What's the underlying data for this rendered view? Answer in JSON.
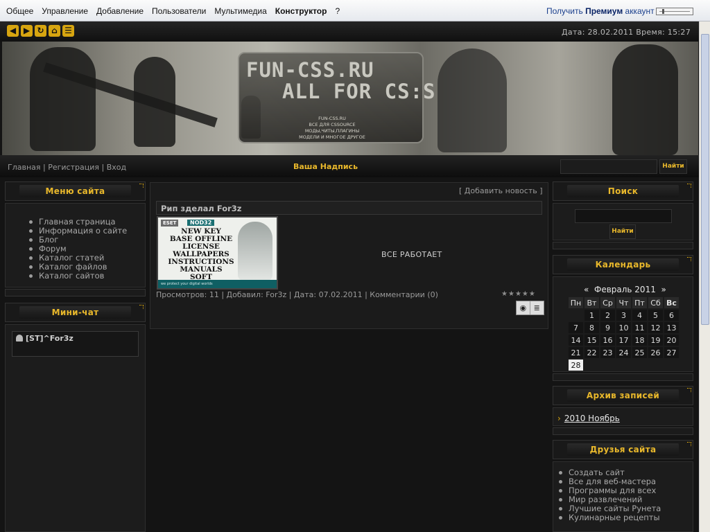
{
  "topbar": {
    "menu": [
      "Общее",
      "Управление",
      "Добавление",
      "Пользователи",
      "Мультимедиа",
      "Конструктор",
      "?"
    ],
    "premium_prefix": "Получить ",
    "premium_bold": "Премиум",
    "premium_suffix": " аккаунт"
  },
  "header": {
    "datetime": "Дата: 28.02.2011 Время: 15:27",
    "icons": [
      "arrow-left-icon",
      "arrow-right-icon",
      "refresh-icon",
      "home-icon",
      "rss-icon"
    ]
  },
  "banner": {
    "logo_line1": "FUN-CSS.RU",
    "logo_line2": "ALL FOR CS:S",
    "small_lines": [
      "FUN-CSS.RU",
      "ВСЕ ДЛЯ CSSOURCE",
      "МОДЫ,ЧИТЫ,ПЛАГИНЫ",
      "МОДЕЛИ И МНОГОЕ ДРУГОЕ"
    ]
  },
  "navbar": {
    "link_home": "Главная",
    "link_register": "Регистрация",
    "link_login": "Вход",
    "separator": " | ",
    "caption": "Ваша Надпись",
    "search_button": "Найти"
  },
  "left": {
    "menu_title": "Меню сайта",
    "menu_items": [
      "Главная страница",
      "Информация о сайте",
      "Блог",
      "Форум",
      "Каталог статей",
      "Каталог файлов",
      "Каталог сайтов"
    ],
    "chat_title": "Мини-чат",
    "chat_user": "[ST]^For3z"
  },
  "content": {
    "add_news": "[ Добавить новость ]",
    "post_title": "Рип зделал For3z",
    "post_text": "ВСЕ РАБОТАЕТ",
    "meta": "Просмотров: 11 | Добавил: For3z | Дата: 07.02.2011 | Комментарии (0)",
    "thumb": {
      "brand": "ESET",
      "product": "NOD32",
      "lines": [
        "NEW KEY",
        "BASE OFFLINE",
        "LICENSE",
        "WALLPAPERS",
        "INSTRUCTIONS",
        "MANUALS",
        "SOFT"
      ],
      "tagline": "we protect your digital worlds"
    },
    "rating_stars": 5
  },
  "right": {
    "search_title": "Поиск",
    "search_button": "Найти",
    "calendar_title": "Календарь",
    "calendar_month": "Февраль 2011",
    "calendar_prev": "«",
    "calendar_next": "»",
    "weekdays": [
      "Пн",
      "Вт",
      "Ср",
      "Чт",
      "Пт",
      "Сб",
      "Вс"
    ],
    "weeks": [
      [
        "",
        "1",
        "2",
        "3",
        "4",
        "5",
        "6"
      ],
      [
        "7",
        "8",
        "9",
        "10",
        "11",
        "12",
        "13"
      ],
      [
        "14",
        "15",
        "16",
        "17",
        "18",
        "19",
        "20"
      ],
      [
        "21",
        "22",
        "23",
        "24",
        "25",
        "26",
        "27"
      ],
      [
        "28",
        "",
        "",
        "",
        "",
        "",
        ""
      ]
    ],
    "today": "28",
    "archive_title": "Архив записей",
    "archive_link": "2010 Ноябрь",
    "friends_title": "Друзья сайта",
    "friends": [
      "Создать сайт",
      "Все для веб-мастера",
      "Программы для всех",
      "Мир развлечений",
      "Лучшие сайты Рунета",
      "Кулинарные рецепты"
    ]
  },
  "colors": {
    "accent": "#e9b82b",
    "background": "#141414",
    "panel": "#1c1c1c"
  }
}
